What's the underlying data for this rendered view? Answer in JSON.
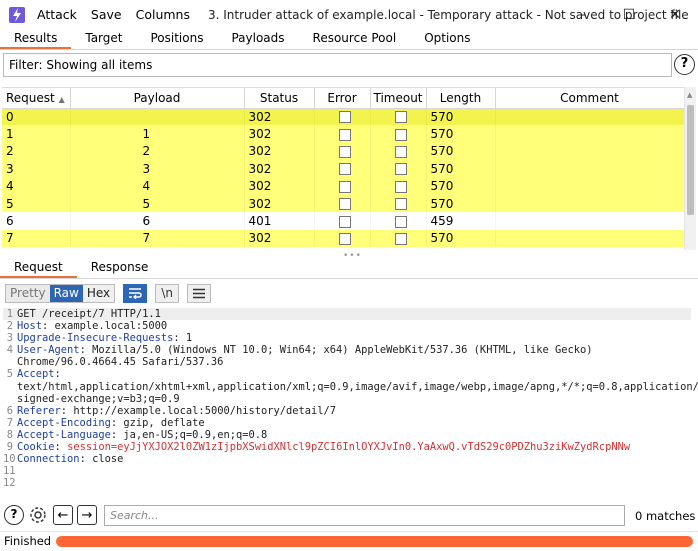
{
  "titlebar": {
    "menu": [
      "Attack",
      "Save",
      "Columns"
    ],
    "title": "3. Intruder attack of example.local - Temporary attack - Not saved to project file"
  },
  "tabs": [
    "Results",
    "Target",
    "Positions",
    "Payloads",
    "Resource Pool",
    "Options"
  ],
  "filter": {
    "text": "Filter: Showing all items"
  },
  "table": {
    "columns": [
      "Request",
      "Payload",
      "Status",
      "Error",
      "Timeout",
      "Length",
      "Comment"
    ],
    "rows": [
      {
        "request": "0",
        "payload": "",
        "status": "302",
        "length": "570"
      },
      {
        "request": "1",
        "payload": "1",
        "status": "302",
        "length": "570"
      },
      {
        "request": "2",
        "payload": "2",
        "status": "302",
        "length": "570"
      },
      {
        "request": "3",
        "payload": "3",
        "status": "302",
        "length": "570"
      },
      {
        "request": "4",
        "payload": "4",
        "status": "302",
        "length": "570"
      },
      {
        "request": "5",
        "payload": "5",
        "status": "302",
        "length": "570"
      },
      {
        "request": "6",
        "payload": "6",
        "status": "401",
        "length": "459"
      },
      {
        "request": "7",
        "payload": "7",
        "status": "302",
        "length": "570"
      }
    ]
  },
  "rr_tabs": [
    "Request",
    "Response"
  ],
  "editor_toolbar": {
    "pretty": "Pretty",
    "raw": "Raw",
    "hex": "Hex",
    "newline": "\\n"
  },
  "editor": {
    "lines": [
      {
        "num": "1",
        "name": "",
        "value": "GET /receipt/7 HTTP/1.1"
      },
      {
        "num": "2",
        "name": "Host",
        "value": " example.local:5000"
      },
      {
        "num": "3",
        "name": "Upgrade-Insecure-Requests",
        "value": " 1"
      },
      {
        "num": "4",
        "name": "User-Agent",
        "value": " Mozilla/5.0 (Windows NT 10.0; Win64; x64) AppleWebKit/537.36 (KHTML, like Gecko)"
      },
      {
        "num": "",
        "name": "",
        "value": "Chrome/96.0.4664.45 Safari/537.36"
      },
      {
        "num": "5",
        "name": "Accept",
        "value": ""
      },
      {
        "num": "",
        "name": "",
        "value": "text/html,application/xhtml+xml,application/xml;q=0.9,image/avif,image/webp,image/apng,*/*;q=0.8,application/"
      },
      {
        "num": "",
        "name": "",
        "value": "signed-exchange;v=b3;q=0.9"
      },
      {
        "num": "6",
        "name": "Referer",
        "value": " http://example.local:5000/history/detail/7"
      },
      {
        "num": "7",
        "name": "Accept-Encoding",
        "value": " gzip, deflate"
      },
      {
        "num": "8",
        "name": "Accept-Language",
        "value": " ja,en-US;q=0.9,en;q=0.8"
      },
      {
        "num": "9",
        "name": "Cookie",
        "value": " ",
        "cookie": "session=eyJjYXJOX2l0ZW1zIjpbXSwidXNlcl9pZCI6InlOYXJvIn0.YaAxwQ.vTdS29c0PDZhu3ziKwZydRcpNNw"
      },
      {
        "num": "10",
        "name": "Connection",
        "value": " close"
      },
      {
        "num": "11",
        "name": "",
        "value": ""
      },
      {
        "num": "12",
        "name": "",
        "value": ""
      }
    ]
  },
  "search": {
    "placeholder": "Search...",
    "matches": "0 matches"
  },
  "status": {
    "text": "Finished",
    "progress_percent": 100
  },
  "colors": {
    "accent": "#e8703a",
    "highlight": "#ffff7a",
    "progress": "#ff6633",
    "header_name": "#1e3fa6",
    "cookie": "#d23232"
  }
}
